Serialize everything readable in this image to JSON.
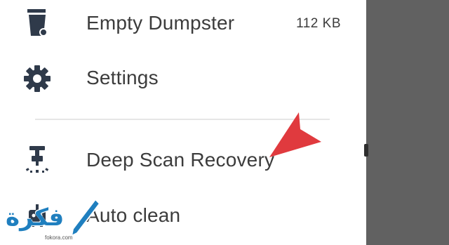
{
  "menu": {
    "items": [
      {
        "label": "Empty Dumpster",
        "meta": "112 KB",
        "icon": "trash-icon"
      },
      {
        "label": "Settings",
        "icon": "gear-icon"
      },
      {
        "label": "Deep Scan Recovery",
        "icon": "deep-scan-icon"
      },
      {
        "label": "Auto clean",
        "icon": "robot-icon"
      }
    ]
  },
  "annotation": {
    "color": "#e03a3e"
  },
  "watermark": {
    "text": "فكرة",
    "url": "fokora.com"
  },
  "colors": {
    "icon": "#2f3a4a",
    "text": "#3c3c3c",
    "scrim": "#616161"
  }
}
